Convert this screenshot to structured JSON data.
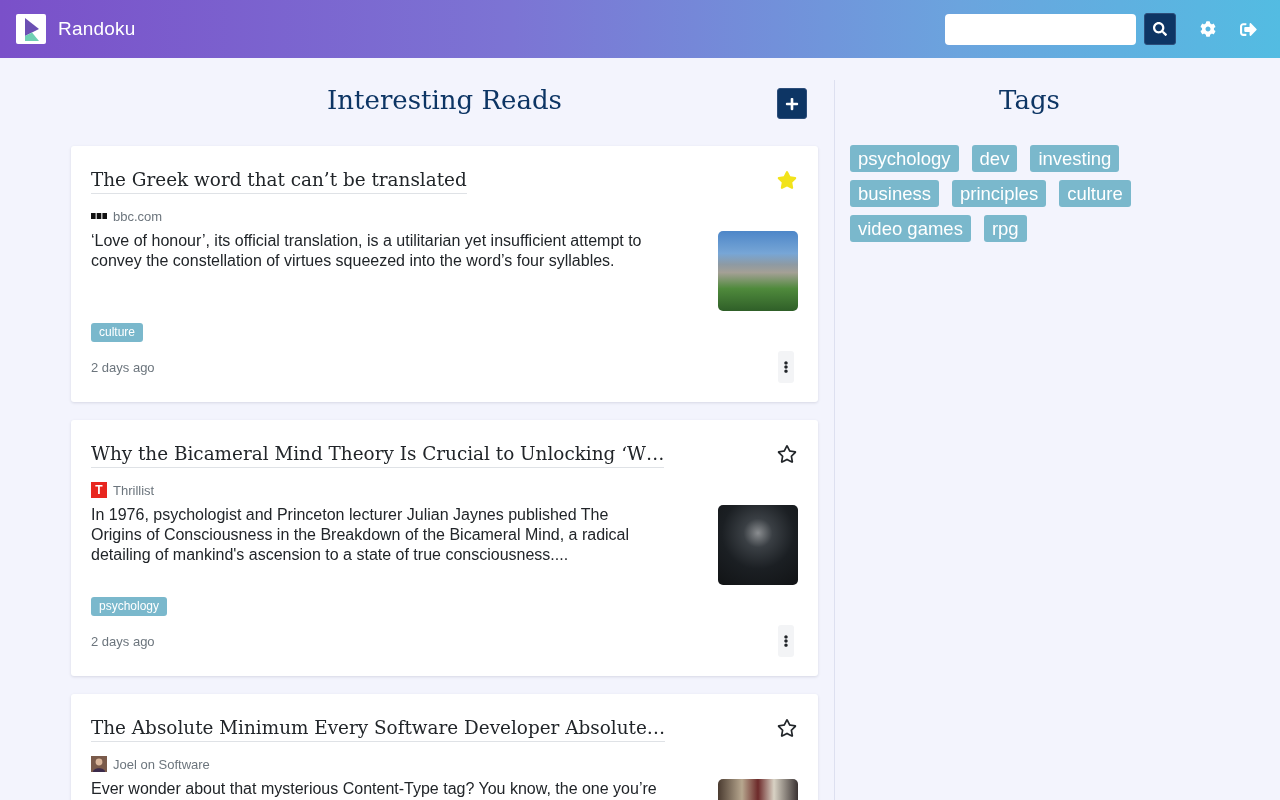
{
  "header": {
    "app_name": "Randoku"
  },
  "reads": {
    "title": "Interesting Reads",
    "articles": [
      {
        "title": "The Greek word that can’t be translated",
        "starred": true,
        "source": {
          "name": "bbc.com",
          "kind": "blocks"
        },
        "summary": "‘Love of honour’, its official translation, is a utilitarian yet insufficient attempt to convey the constellation of virtues squeezed into the word’s four syllables.",
        "tags": [
          "culture"
        ],
        "age": "2 days ago"
      },
      {
        "title": "Why the Bicameral Mind Theory Is Crucial to Unlocking ‘W…",
        "starred": false,
        "source": {
          "name": "Thrillist",
          "kind": "letter",
          "logo_text": "T"
        },
        "summary": "In 1976, psychologist and Princeton lecturer Julian Jaynes published The Origins of Consciousness in the Breakdown of the Bicameral Mind, a radical detailing of mankind's ascension to a state of true consciousness....",
        "tags": [
          "psychology"
        ],
        "age": "2 days ago"
      },
      {
        "title": "The Absolute Minimum Every Software Developer Absolute…",
        "starred": false,
        "source": {
          "name": "Joel on Software",
          "kind": "photo"
        },
        "summary": "Ever wonder about that mysterious Content-Type tag? You know, the one you’re"
      }
    ]
  },
  "tag_panel": {
    "title": "Tags",
    "items": [
      "psychology",
      "dev",
      "investing",
      "business",
      "principles",
      "culture",
      "video games",
      "rpg"
    ]
  }
}
